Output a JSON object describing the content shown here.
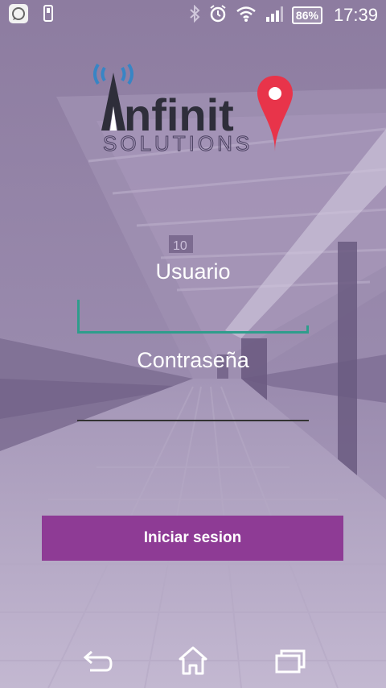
{
  "status_bar": {
    "battery_level": "86%",
    "time": "17:39",
    "icons": [
      "messenger-icon",
      "phone-icon",
      "bluetooth-icon",
      "alarm-icon",
      "wifi-icon",
      "signal-icon",
      "battery-icon"
    ]
  },
  "logo": {
    "brand_main": "nfinit",
    "brand_sub": "SOLUTIONS",
    "accent_color": "#e8344a",
    "signal_color": "#2f86c9"
  },
  "form": {
    "username_label": "Usuario",
    "password_label": "Contraseña",
    "username_underline_color": "#2f9d8c",
    "password_underline_color": "#333333"
  },
  "login_button": {
    "label": "Iniciar sesion",
    "color": "#8e3b95"
  },
  "nav_bar": {
    "icons": [
      "back-icon",
      "home-icon",
      "recent-apps-icon"
    ]
  }
}
